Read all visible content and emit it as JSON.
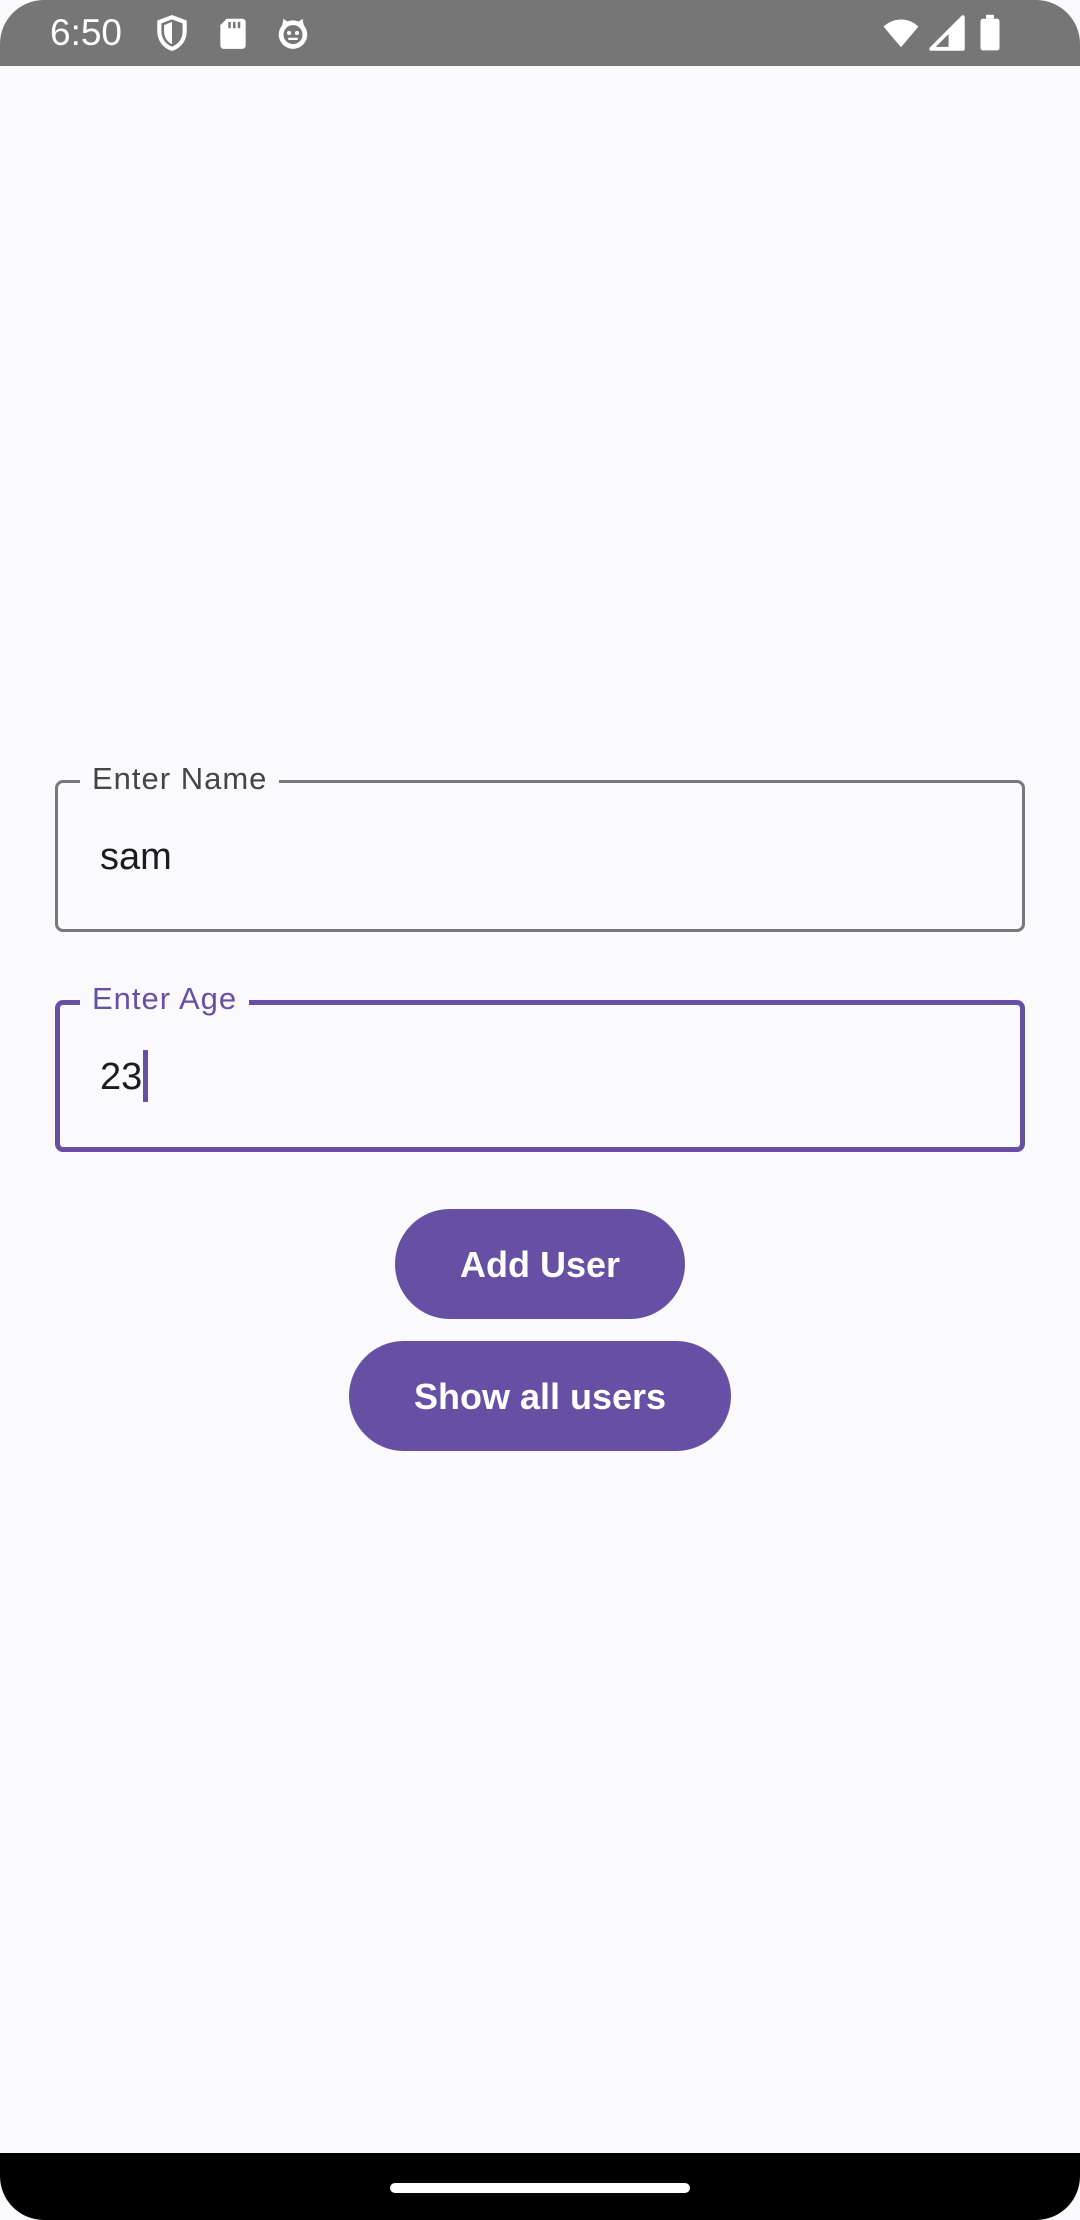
{
  "status_bar": {
    "time": "6:50",
    "left_icons": [
      "shield-icon",
      "sd-card-icon",
      "cat-face-icon"
    ],
    "right_icons": [
      "wifi-icon",
      "cellular-signal-icon",
      "battery-icon"
    ],
    "background": "#767676"
  },
  "form": {
    "name_field": {
      "label": "Enter Name",
      "value": "sam"
    },
    "age_field": {
      "label": "Enter Age",
      "value": "23",
      "focused": true
    }
  },
  "buttons": {
    "add_user": "Add User",
    "show_all_users": "Show all users"
  },
  "colors": {
    "primary": "#6750a4",
    "background": "#faf9fb",
    "outline": "#7a757f",
    "on_primary": "#ffffff"
  }
}
